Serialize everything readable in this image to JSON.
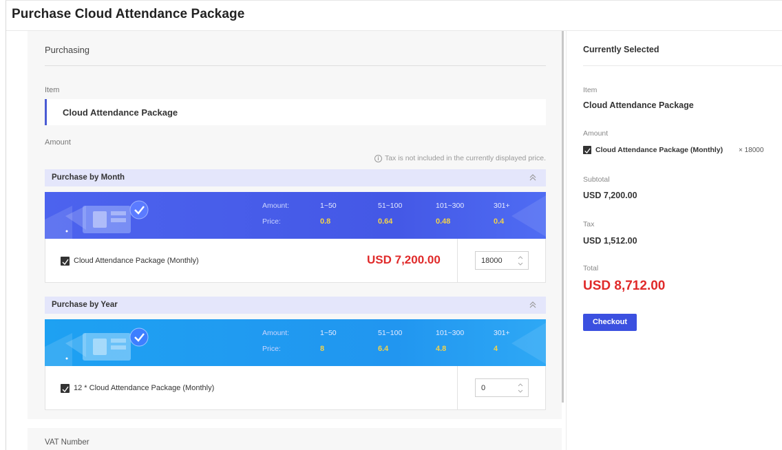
{
  "page": {
    "title": "Purchase Cloud Attendance Package"
  },
  "purchasing": {
    "section_title": "Purchasing",
    "item_label": "Item",
    "item_value": "Cloud Attendance Package",
    "amount_label": "Amount",
    "tax_note": "Tax is not included in the currently displayed price.",
    "info_icon": "info-circle-icon",
    "groups": [
      {
        "header": "Purchase by Month",
        "banner_color": "#4458e6",
        "amount_label": "Amount:",
        "price_label": "Price:",
        "tiers": [
          {
            "range": "1~50",
            "price": "0.8"
          },
          {
            "range": "51~100",
            "price": "0.64"
          },
          {
            "range": "101~300",
            "price": "0.48"
          },
          {
            "range": "301+",
            "price": "0.4"
          }
        ],
        "product_name": "Cloud Attendance Package (Monthly)",
        "product_price": "USD 7,200.00",
        "quantity": "18000"
      },
      {
        "header": "Purchase by Year",
        "banner_color": "#2196f0",
        "amount_label": "Amount:",
        "price_label": "Price:",
        "tiers": [
          {
            "range": "1~50",
            "price": "8"
          },
          {
            "range": "51~100",
            "price": "6.4"
          },
          {
            "range": "101~300",
            "price": "4.8"
          },
          {
            "range": "301+",
            "price": "4"
          }
        ],
        "product_name": "12 * Cloud Attendance Package (Monthly)",
        "product_price": "",
        "quantity": "0"
      }
    ],
    "vat_label": "VAT Number"
  },
  "summary": {
    "title": "Currently Selected",
    "item_label": "Item",
    "item_value": "Cloud Attendance Package",
    "amount_label": "Amount",
    "amount_product": "Cloud Attendance Package (Monthly)",
    "amount_qty": "× 18000",
    "subtotal_label": "Subtotal",
    "subtotal_value": "USD 7,200.00",
    "tax_label": "Tax",
    "tax_value": "USD 1,512.00",
    "total_label": "Total",
    "total_value": "USD 8,712.00",
    "checkout_label": "Checkout"
  },
  "colors": {
    "accent": "#3b50e0",
    "price_red": "#e02a2a",
    "tier_price_yellow": "#f3d34a"
  }
}
